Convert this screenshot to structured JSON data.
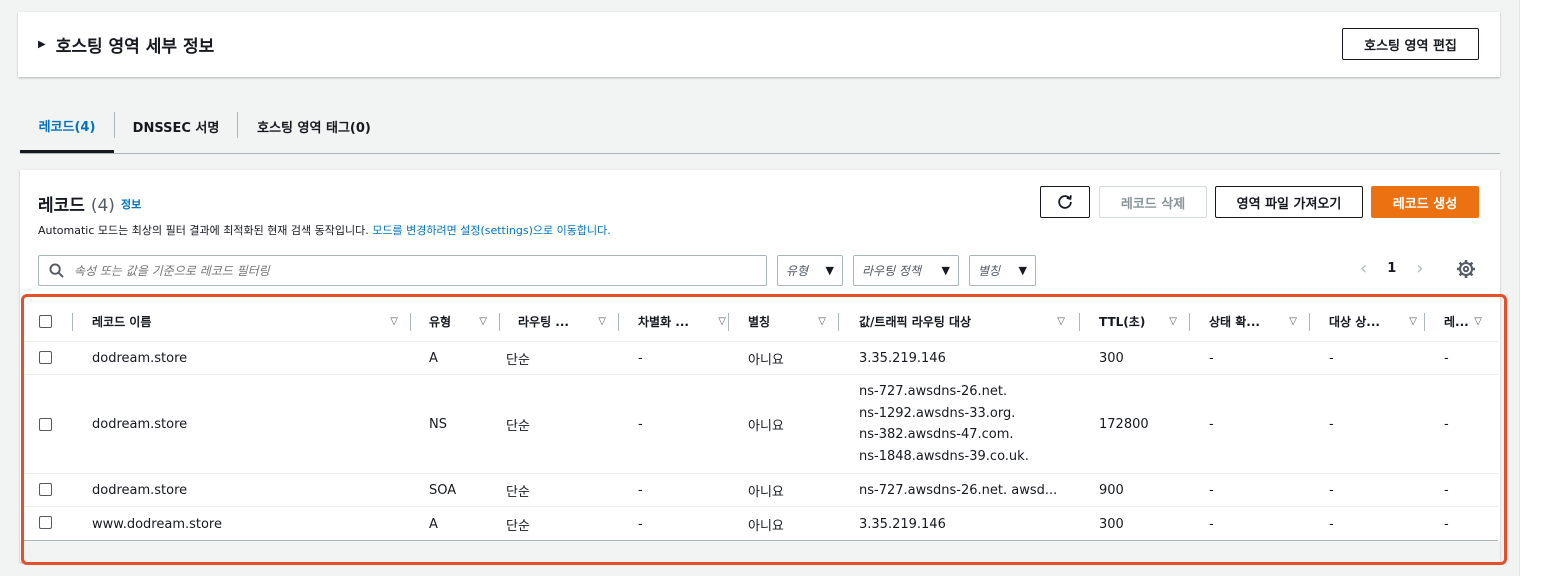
{
  "details": {
    "title": "호스팅 영역 세부 정보",
    "edit_button": "호스팅 영역 편집"
  },
  "tabs": [
    {
      "label": "레코드(4)"
    },
    {
      "label": "DNSSEC 서명"
    },
    {
      "label": "호스팅 영역 태그(0)"
    }
  ],
  "records": {
    "title": "레코드",
    "count": "(4)",
    "info": "정보",
    "description_prefix": "Automatic 모드는 최상의 필터 결과에 최적화된 현재 검색 동작입니다. ",
    "description_link": "모드를 변경하려면 설정(settings)으로 이동합니다.",
    "buttons": {
      "delete": "레코드 삭제",
      "import": "영역 파일 가져오기",
      "create": "레코드 생성"
    },
    "search_placeholder": "속성 또는 값을 기준으로 레코드 필터링",
    "filters": {
      "type": "유형",
      "routing": "라우팅 정책",
      "alias": "별칭"
    },
    "page": "1"
  },
  "table": {
    "headers": {
      "name": "레코드 이름",
      "type": "유형",
      "routing": "라우팅 ...",
      "differentiator": "차별화 ...",
      "alias": "별칭",
      "value": "값/트래픽 라우팅 대상",
      "ttl": "TTL(초)",
      "health": "상태 확...",
      "target_health": "대상 상...",
      "record_id": "레..."
    },
    "rows": [
      {
        "name": "dodream.store",
        "type": "A",
        "routing": "단순",
        "differentiator": "-",
        "alias": "아니요",
        "value": [
          "3.35.219.146"
        ],
        "ttl": "300",
        "health": "-",
        "target_health": "-",
        "record_id": "-"
      },
      {
        "name": "dodream.store",
        "type": "NS",
        "routing": "단순",
        "differentiator": "-",
        "alias": "아니요",
        "value": [
          "ns-727.awsdns-26.net.",
          "ns-1292.awsdns-33.org.",
          "ns-382.awsdns-47.com.",
          "ns-1848.awsdns-39.co.uk."
        ],
        "ttl": "172800",
        "health": "-",
        "target_health": "-",
        "record_id": "-"
      },
      {
        "name": "dodream.store",
        "type": "SOA",
        "routing": "단순",
        "differentiator": "-",
        "alias": "아니요",
        "value": [
          "ns-727.awsdns-26.net. awsd..."
        ],
        "ttl": "900",
        "health": "-",
        "target_health": "-",
        "record_id": "-"
      },
      {
        "name": "www.dodream.store",
        "type": "A",
        "routing": "단순",
        "differentiator": "-",
        "alias": "아니요",
        "value": [
          "3.35.219.146"
        ],
        "ttl": "300",
        "health": "-",
        "target_health": "-",
        "record_id": "-"
      }
    ]
  },
  "colors": {
    "accent": "#0073bb",
    "primary_button": "#ec7211",
    "highlight": "#e5502c"
  }
}
